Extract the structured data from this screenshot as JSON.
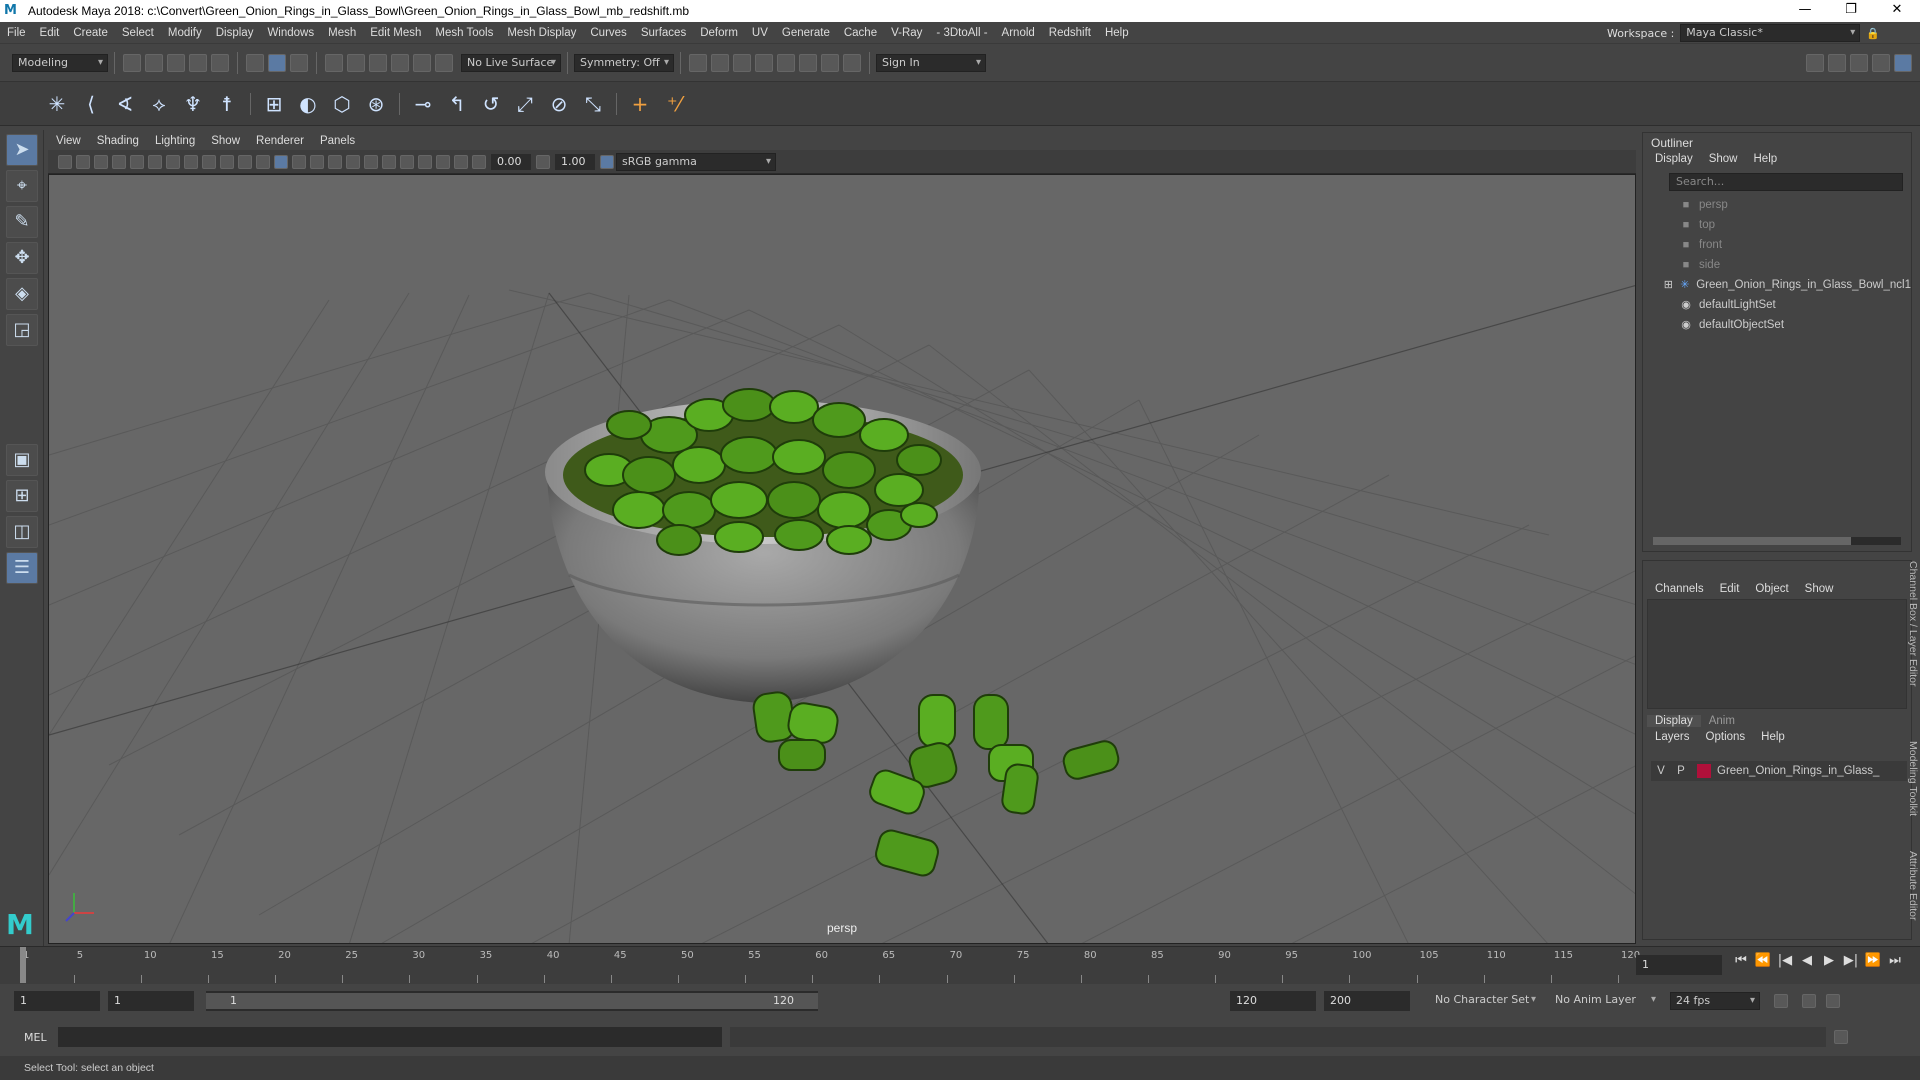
{
  "window": {
    "app_logo": "M",
    "title": "Autodesk Maya 2018: c:\\Convert\\Green_Onion_Rings_in_Glass_Bowl\\Green_Onion_Rings_in_Glass_Bowl_mb_redshift.mb",
    "minimize": "—",
    "maximize": "❐",
    "close": "✕"
  },
  "menubar": {
    "items": [
      "File",
      "Edit",
      "Create",
      "Select",
      "Modify",
      "Display",
      "Windows",
      "Mesh",
      "Edit Mesh",
      "Mesh Tools",
      "Mesh Display",
      "Curves",
      "Surfaces",
      "Deform",
      "UV",
      "Generate",
      "Cache",
      "V-Ray",
      "- 3DtoAll -",
      "Arnold",
      "Redshift",
      "Help"
    ],
    "workspace_label": "Workspace :",
    "workspace_value": "Maya Classic*"
  },
  "statusline": {
    "mode": "Modeling",
    "live_surface": "No Live Surface",
    "symmetry": "Symmetry: Off",
    "sign_in": "Sign In"
  },
  "viewport": {
    "menu": [
      "View",
      "Shading",
      "Lighting",
      "Show",
      "Renderer",
      "Panels"
    ],
    "exposure": "0.00",
    "gamma": "1.00",
    "color_space": "sRGB gamma",
    "camera_label": "persp"
  },
  "outliner": {
    "title": "Outliner",
    "menu": [
      "Display",
      "Show",
      "Help"
    ],
    "search_placeholder": "Search...",
    "items": [
      {
        "label": "persp",
        "icon": "camera-icon",
        "dim": true
      },
      {
        "label": "top",
        "icon": "camera-icon",
        "dim": true
      },
      {
        "label": "front",
        "icon": "camera-icon",
        "dim": true
      },
      {
        "label": "side",
        "icon": "camera-icon",
        "dim": true
      },
      {
        "label": "Green_Onion_Rings_in_Glass_Bowl_ncl1",
        "icon": "group-icon",
        "dim": false
      },
      {
        "label": "defaultLightSet",
        "icon": "set-icon",
        "dim": false
      },
      {
        "label": "defaultObjectSet",
        "icon": "set-icon",
        "dim": false
      }
    ]
  },
  "channelbox": {
    "menu": [
      "Channels",
      "Edit",
      "Object",
      "Show"
    ],
    "layer_tabs": [
      "Display",
      "Anim"
    ],
    "layer_menu": [
      "Layers",
      "Options",
      "Help"
    ],
    "layer": {
      "v": "V",
      "p": "P",
      "name": "Green_Onion_Rings_in_Glass_",
      "color": "#b0103a"
    },
    "side_tabs": [
      "Channel Box / Layer Editor",
      "Modeling Toolkit",
      "Attribute Editor"
    ]
  },
  "timeslider": {
    "ticks": [
      1,
      5,
      10,
      15,
      20,
      25,
      30,
      35,
      40,
      45,
      50,
      55,
      60,
      65,
      70,
      75,
      80,
      85,
      90,
      95,
      100,
      105,
      110,
      115,
      120
    ],
    "current_frame": "1",
    "playback": [
      "⏮",
      "⏪",
      "|◀",
      "◀",
      "▶",
      "▶|",
      "⏩",
      "⏭"
    ]
  },
  "range": {
    "start": "1",
    "anim_start": "1",
    "range_start": "1",
    "range_end": "120",
    "anim_end": "120",
    "end": "200",
    "character_set": "No Character Set",
    "anim_layer": "No Anim Layer",
    "fps": "24 fps"
  },
  "cmdline": {
    "lang": "MEL"
  },
  "helpline": {
    "text": "Select Tool: select an object"
  }
}
